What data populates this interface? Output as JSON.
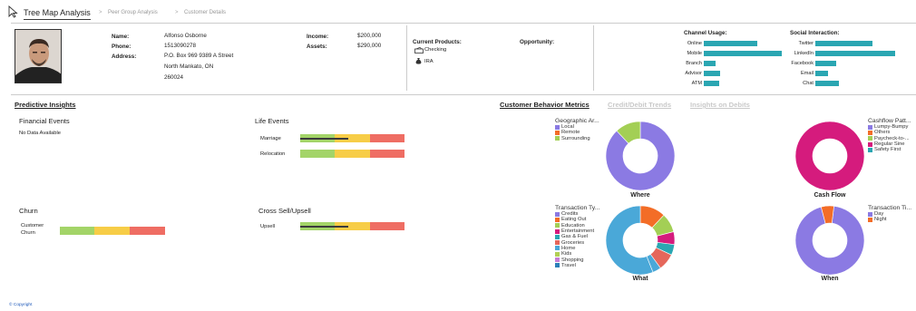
{
  "breadcrumb": {
    "main": "Tree Map Analysis",
    "sep1": ">",
    "peer": "Peer Group Analysis",
    "sep2": ">",
    "customer": "Customer Details"
  },
  "customer": {
    "name_label": "Name:",
    "name": "Alfonso Osborne",
    "phone_label": "Phone:",
    "phone": "1513090278",
    "address_label": "Address:",
    "address1": "P.O. Box 969 9389 A Street",
    "address2": "North Mankato, ON",
    "address3": "260024",
    "income_label": "Income:",
    "income": "$200,000",
    "assets_label": "Assets:",
    "assets": "$290,000"
  },
  "products": {
    "title": "Current Products:",
    "items": [
      "Checking",
      "IRA"
    ],
    "opportunity": "Opportunity:"
  },
  "channel_usage": {
    "title": "Channel Usage:",
    "items": [
      {
        "label": "Online",
        "value": 0.65
      },
      {
        "label": "Mobile",
        "value": 0.95
      },
      {
        "label": "Branch",
        "value": 0.14
      },
      {
        "label": "Advisor",
        "value": 0.2
      },
      {
        "label": "ATM",
        "value": 0.19
      }
    ]
  },
  "social": {
    "title": "Social Interaction:",
    "items": [
      {
        "label": "Twitter",
        "value": 0.7
      },
      {
        "label": "LinkedIn",
        "value": 0.98
      },
      {
        "label": "Facebook",
        "value": 0.26
      },
      {
        "label": "Email",
        "value": 0.16
      },
      {
        "label": "Chat",
        "value": 0.29
      }
    ]
  },
  "insights": {
    "title": "Predictive Insights",
    "financial_title": "Financial Events",
    "no_data": "No Data Available",
    "life_title": "Life Events",
    "marriage": "Marriage",
    "relocation": "Relocation",
    "churn_title": "Churn",
    "customer_churn_1": "Customer",
    "customer_churn_2": "Churn",
    "cross_title": "Cross Sell/Upsell",
    "upsell": "Upsell",
    "marriage_level": 0.46,
    "relocation_level": 0,
    "churn_level": 0,
    "upsell_level": 0.46
  },
  "tabs": {
    "behavior": "Customer Behavior Metrics",
    "trends": "Credit/Debit Trends",
    "debits": "Insights on Debits"
  },
  "colors": {
    "purple": "#8b7ae3",
    "orange": "#f36d27",
    "green": "#a3cf55",
    "magenta": "#d51b7d",
    "teal": "#2aa6b2",
    "blue": "#2c7fb8",
    "lightblue": "#4aa8d8"
  },
  "chart_data": [
    {
      "type": "pie",
      "title": "Where",
      "legend_title": "Geographic Ar...",
      "categories": [
        "Local",
        "Remote",
        "Surrounding"
      ],
      "values": [
        88,
        0,
        12
      ]
    },
    {
      "type": "pie",
      "title": "Cash Flow",
      "legend_title": "Cashflow Patt...",
      "categories": [
        "Lumpy-Bumpy",
        "Others",
        "Paycheck-to-...",
        "Regular Sine",
        "Safety First"
      ],
      "values": [
        0,
        0,
        0,
        100,
        0
      ]
    },
    {
      "type": "pie",
      "title": "What",
      "legend_title": "Transaction Ty...",
      "categories": [
        "Credits",
        "Eating Out",
        "Education",
        "Entertainment",
        "Gas & Fuel",
        "Groceries",
        "Home",
        "Kids",
        "Shopping",
        "Travel"
      ],
      "values": [
        0,
        12,
        9,
        6,
        5,
        8,
        4,
        0,
        0,
        56
      ]
    },
    {
      "type": "pie",
      "title": "When",
      "legend_title": "Transaction Ti...",
      "categories": [
        "Day",
        "Night"
      ],
      "values": [
        94,
        6
      ]
    }
  ],
  "copyright": "© Copyright"
}
